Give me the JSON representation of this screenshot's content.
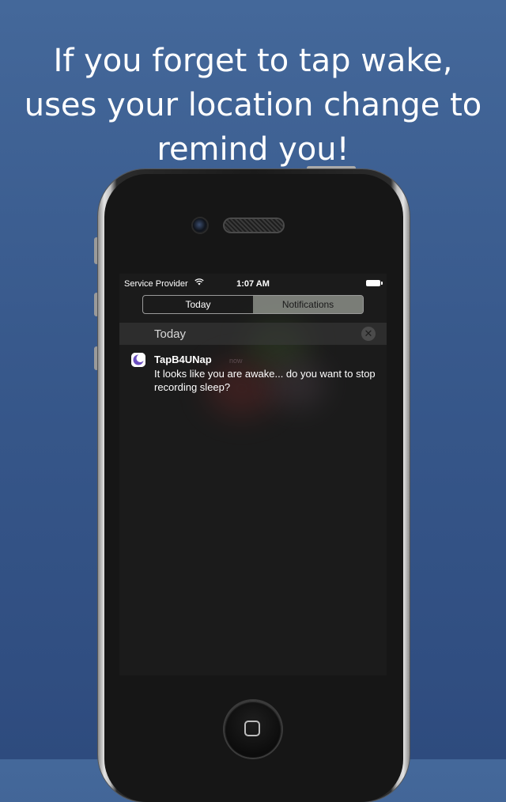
{
  "headline": {
    "line1": "If you forget to tap wake,",
    "line2": "uses your location change to",
    "line3": "remind you!"
  },
  "status_bar": {
    "carrier": "Service Provider",
    "time": "1:07 AM",
    "wifi_icon": "wifi-icon",
    "battery_icon": "battery-icon"
  },
  "segmented_control": {
    "tabs": [
      {
        "label": "Today",
        "selected": false
      },
      {
        "label": "Notifications",
        "selected": true
      }
    ]
  },
  "section": {
    "title": "Today",
    "clear_icon": "close-icon"
  },
  "notification": {
    "app_name": "TapB4UNap",
    "time": "now",
    "message": "It looks like you are awake... do you want to stop recording sleep?",
    "icon": "app-moon-icon"
  },
  "colors": {
    "background_top": "#44689a",
    "background_bottom": "#2e4b7e",
    "screen_background": "#1b1b1b",
    "selected_tab": "#c8cdc3"
  }
}
